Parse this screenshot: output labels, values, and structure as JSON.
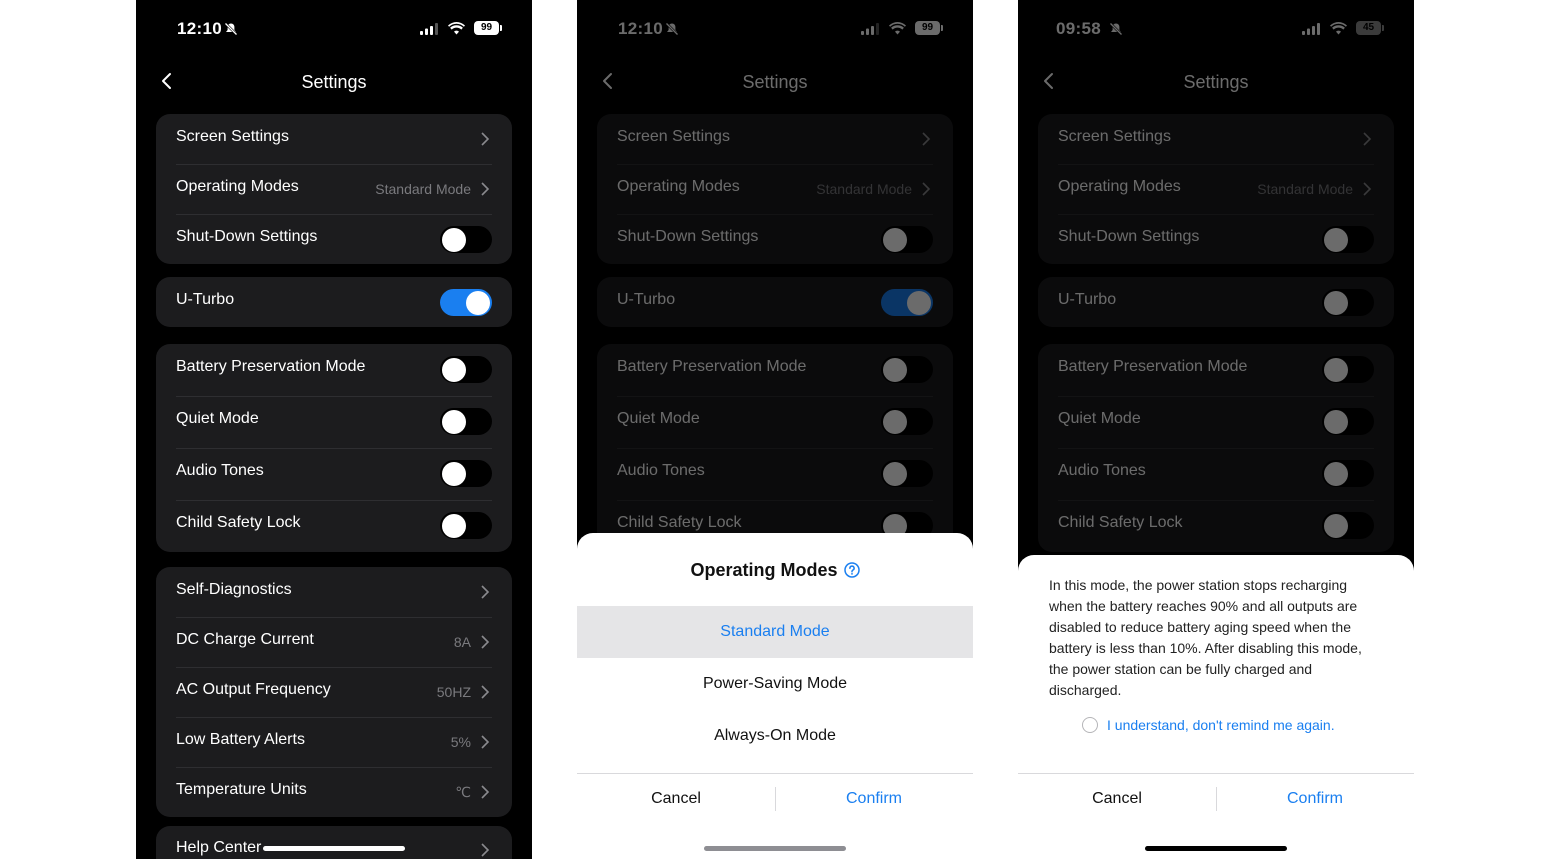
{
  "colors": {
    "accent": "#1a7ff0",
    "background": "#000000",
    "card": "#1c1c1e",
    "sheet": "#ffffff"
  },
  "phone1": {
    "time": "12:10",
    "battery": "99",
    "title": "Settings",
    "groups": [
      {
        "rows": [
          {
            "label": "Screen Settings",
            "type": "nav"
          },
          {
            "label": "Operating Modes",
            "value": "Standard Mode",
            "type": "nav"
          },
          {
            "label": "Shut-Down Settings",
            "type": "toggle",
            "on": false
          }
        ]
      },
      {
        "rows": [
          {
            "label": "U-Turbo",
            "type": "toggle",
            "on": true
          }
        ]
      },
      {
        "rows": [
          {
            "label": "Battery Preservation Mode",
            "type": "toggle",
            "on": false
          },
          {
            "label": "Quiet Mode",
            "type": "toggle",
            "on": false
          },
          {
            "label": "Audio Tones",
            "type": "toggle",
            "on": false
          },
          {
            "label": "Child Safety Lock",
            "type": "toggle",
            "on": false
          }
        ]
      },
      {
        "rows": [
          {
            "label": "Self-Diagnostics",
            "type": "nav"
          },
          {
            "label": "DC Charge Current",
            "value": "8A",
            "type": "nav"
          },
          {
            "label": "AC Output Frequency",
            "value": "50HZ",
            "type": "nav"
          },
          {
            "label": "Low Battery Alerts",
            "value": "5%",
            "type": "nav"
          },
          {
            "label": "Temperature Units",
            "value": "℃",
            "type": "nav"
          }
        ]
      },
      {
        "rows": [
          {
            "label": "Help Center",
            "type": "nav"
          }
        ]
      }
    ]
  },
  "phone2": {
    "time": "12:10",
    "battery": "99",
    "title": "Settings",
    "sheet": {
      "title": "Operating Modes",
      "options": [
        "Standard Mode",
        "Power-Saving Mode",
        "Always-On Mode"
      ],
      "selected": "Standard Mode",
      "cancel": "Cancel",
      "confirm": "Confirm"
    }
  },
  "phone3": {
    "time": "09:58",
    "battery": "45",
    "title": "Settings",
    "dialog": {
      "text": "In this mode, the power station stops recharging when the battery reaches 90% and all outputs are disabled to reduce battery aging speed when the battery is less than 10%. After disabling this mode, the power station can be fully charged and discharged.",
      "checkbox": "I understand, don't remind me again.",
      "cancel": "Cancel",
      "confirm": "Confirm"
    }
  }
}
